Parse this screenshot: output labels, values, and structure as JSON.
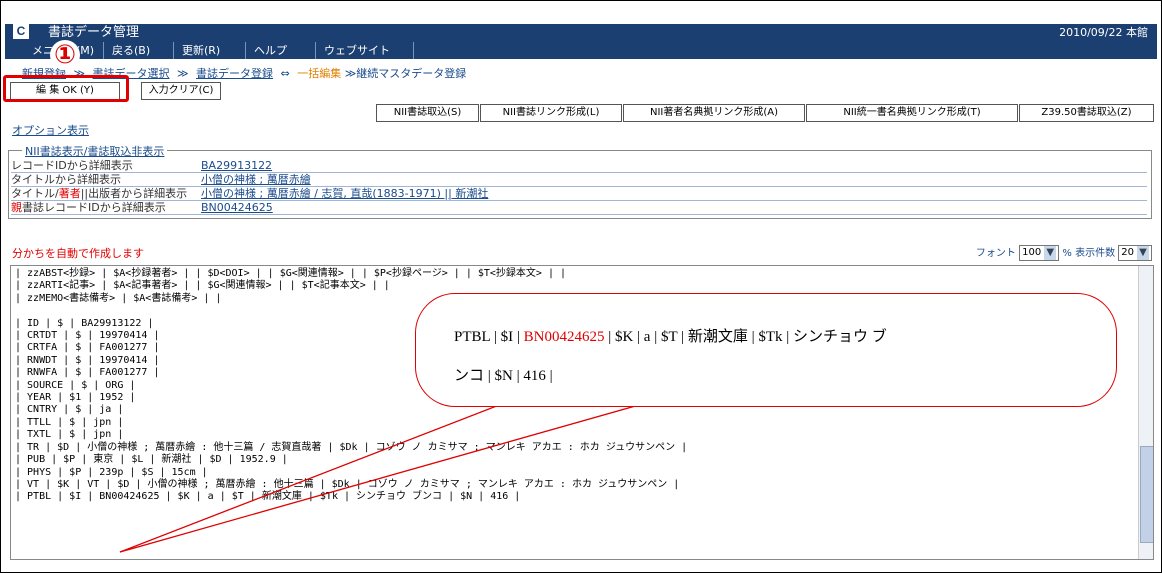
{
  "app": {
    "logo": "C",
    "title": "書誌データ管理",
    "date": "2010/09/22 本館"
  },
  "menu": [
    "メニュー(M)",
    "戻る(B)",
    "更新(R)",
    "ヘルプ",
    "ウェブサイト"
  ],
  "breadcrumb": {
    "link1": "新規登録",
    "link2": "書誌データ選択",
    "sep1": "≫",
    "link3": "書誌データ登録",
    "arrow": "⇔",
    "current": "一括編集",
    "next": "≫継続マスタデータ登録"
  },
  "marker": "①",
  "buttons": {
    "edit_ok": "編 集 OK (Y)",
    "clear": "入力クリア(C)"
  },
  "nii_buttons": [
    "NII書誌取込(S)",
    "NII書誌リンク形成(L)",
    "NII著者名典拠リンク形成(A)",
    "NII統一書名典拠リンク形成(T)",
    "Z39.50書誌取込(Z)"
  ],
  "options_link": "オプション表示",
  "nii_section": {
    "legend": "NII書誌表示/書誌取込非表示",
    "rows": [
      {
        "label": "レコードIDから詳細表示",
        "value": "BA29913122"
      },
      {
        "label": "タイトルから詳細表示",
        "value": "小僧の神様 ; 萬暦赤繪"
      },
      {
        "label_a": "タイトル/",
        "label_b": "著者",
        "label_c": "||出版者から詳細表示",
        "value": "小僧の神様 ; 萬暦赤繪 / 志賀, 直哉(1883-1971) || 新潮社"
      },
      {
        "label_a": "親",
        "label_b": "書誌レコードIDから詳細表示",
        "value": "BN00424625"
      }
    ]
  },
  "auto_note": "分かちを自動で作成します",
  "font_ctl": {
    "font_label": "フォント",
    "font_value": "100",
    "pct_label": "% 表示件数",
    "count_value": "20"
  },
  "editor_lines": [
    "| zzABST<抄録> | $A<抄録著者> | | $D<DOI> | | $G<関連情報> | | $P<抄録ページ> | | $T<抄録本文> | |",
    "| zzARTI<記事> | $A<記事著者> | | $G<関連情報> | | $T<記事本文> | |",
    "| zzMEMO<書誌備考> | $A<書誌備考> | |",
    "",
    "| ID | $ | BA29913122 |",
    "| CRTDT | $ | 19970414 |",
    "| CRTFA | $ | FA001277 |",
    "| RNWDT | $ | 19970414 |",
    "| RNWFA | $ | FA001277 |",
    "| SOURCE | $ | ORG |",
    "| YEAR | $1 | 1952 |",
    "| CNTRY | $ | ja |",
    "| TTLL | $ | jpn |",
    "| TXTL | $ | jpn |",
    "| TR | $D | 小僧の神様 ; 萬暦赤繪 : 他十三篇 / 志賀直哉著 | $Dk | コゾウ ノ カミサマ ; マンレキ アカエ : ホカ ジュウサンペン |",
    "| PUB | $P | 東京 | $L | 新潮社 | $D | 1952.9 |",
    "| PHYS | $P | 239p | $S | 15cm |",
    "| VT | $K | VT | $D | 小僧の神様 ; 萬暦赤繪 : 他十三篇 | $Dk | コゾウ ノ カミサマ ; マンレキ アカエ : ホカ ジュウサンペン |",
    "| PTBL | $I | BN00424625 | $K | a | $T | 新潮文庫 | $Tk | シンチョウ ブンコ | $N | 416 |"
  ],
  "callout": {
    "line1_a": "PTBL | $I | ",
    "line1_id": "BN00424625",
    "line1_b": " | $K | a | $T | 新潮文庫 | $Tk | シンチョウ ブ",
    "line2": "ンコ | $N | 416 |"
  }
}
